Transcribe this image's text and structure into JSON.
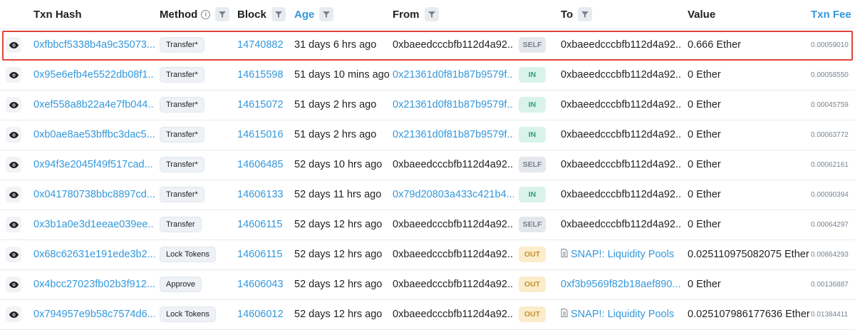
{
  "header": {
    "txn_hash": "Txn Hash",
    "method": "Method",
    "block": "Block",
    "age": "Age",
    "from": "From",
    "to": "To",
    "value": "Value",
    "txn_fee": "Txn Fee"
  },
  "rows": [
    {
      "hash": "0xfbbcf5338b4a9c35073...",
      "method": "Transfer*",
      "block": "14740882",
      "age": "31 days 6 hrs ago",
      "from": "0xbaeedcccbfb112d4a92...",
      "dir": "SELF",
      "to": "0xbaeedcccbfb112d4a92...",
      "value": "0.666 Ether",
      "fee": "0.00059010"
    },
    {
      "hash": "0x95e6efb4e5522db08f1...",
      "method": "Transfer*",
      "block": "14615598",
      "age": "51 days 10 mins ago",
      "from": "0x21361d0f81b87b9579f...",
      "dir": "IN",
      "to": "0xbaeedcccbfb112d4a92...",
      "value": "0 Ether",
      "fee": "0.00058550"
    },
    {
      "hash": "0xef558a8b22a4e7fb044...",
      "method": "Transfer*",
      "block": "14615072",
      "age": "51 days 2 hrs ago",
      "from": "0x21361d0f81b87b9579f...",
      "dir": "IN",
      "to": "0xbaeedcccbfb112d4a92...",
      "value": "0 Ether",
      "fee": "0.00045759"
    },
    {
      "hash": "0xb0ae8ae53bffbc3dac5...",
      "method": "Transfer*",
      "block": "14615016",
      "age": "51 days 2 hrs ago",
      "from": "0x21361d0f81b87b9579f...",
      "dir": "IN",
      "to": "0xbaeedcccbfb112d4a92...",
      "value": "0 Ether",
      "fee": "0.00063772"
    },
    {
      "hash": "0x94f3e2045f49f517cad...",
      "method": "Transfer*",
      "block": "14606485",
      "age": "52 days 10 hrs ago",
      "from": "0xbaeedcccbfb112d4a92...",
      "dir": "SELF",
      "to": "0xbaeedcccbfb112d4a92...",
      "value": "0 Ether",
      "fee": "0.00062161"
    },
    {
      "hash": "0x041780738bbc8897cd...",
      "method": "Transfer*",
      "block": "14606133",
      "age": "52 days 11 hrs ago",
      "from": "0x79d20803a433c421b4...",
      "dir": "IN",
      "to": "0xbaeedcccbfb112d4a92...",
      "value": "0 Ether",
      "fee": "0.00090394"
    },
    {
      "hash": "0x3b1a0e3d1eeae039ee...",
      "method": "Transfer",
      "block": "14606115",
      "age": "52 days 12 hrs ago",
      "from": "0xbaeedcccbfb112d4a92...",
      "dir": "SELF",
      "to": "0xbaeedcccbfb112d4a92...",
      "value": "0 Ether",
      "fee": "0.00064297"
    },
    {
      "hash": "0x68c62631e191ede3b2...",
      "method": "Lock Tokens",
      "block": "14606115",
      "age": "52 days 12 hrs ago",
      "from": "0xbaeedcccbfb112d4a92...",
      "dir": "OUT",
      "to": "SNAP!: Liquidity Pools",
      "value": "0.025110975082075 Ether",
      "fee": "0.00864293"
    },
    {
      "hash": "0x4bcc27023fb02b3f912...",
      "method": "Approve",
      "block": "14606043",
      "age": "52 days 12 hrs ago",
      "from": "0xbaeedcccbfb112d4a92...",
      "dir": "OUT",
      "to": "0xf3b9569f82b18aef890...",
      "value": "0 Ether",
      "fee": "0.00136887"
    },
    {
      "hash": "0x794957e9b58c7574d6...",
      "method": "Lock Tokens",
      "block": "14606012",
      "age": "52 days 12 hrs ago",
      "from": "0xbaeedcccbfb112d4a92...",
      "dir": "OUT",
      "to": "SNAP!: Liquidity Pools",
      "value": "0.025107986177636 Ether",
      "fee": "0.01384411"
    }
  ],
  "colors": {
    "link": "#3498db",
    "highlight_border": "#e0453a",
    "self_badge": "#e4e7ec",
    "in_badge": "#d9f3ea",
    "out_badge": "#fbeccc"
  }
}
